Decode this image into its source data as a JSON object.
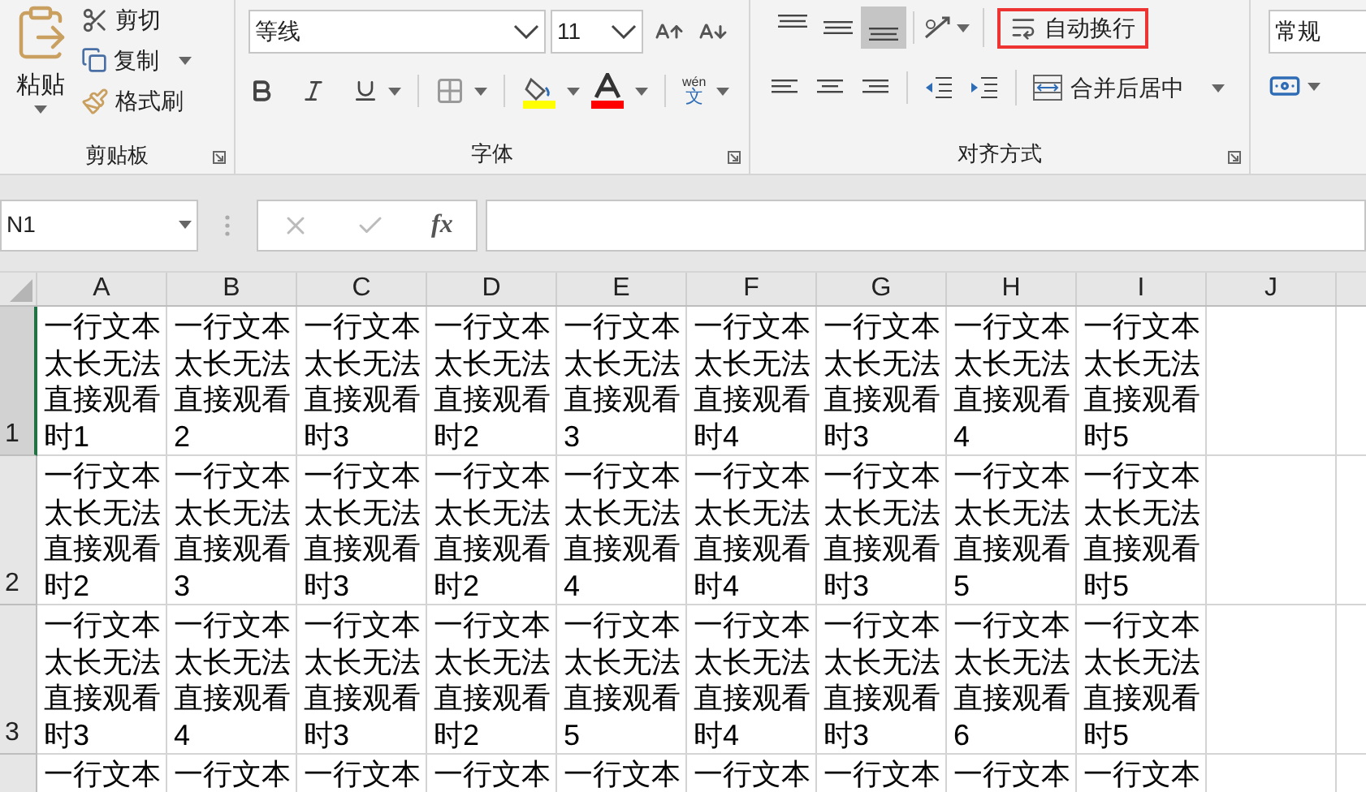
{
  "ribbon": {
    "clipboard": {
      "paste": "粘贴",
      "cut": "剪切",
      "copy": "复制",
      "format_painter": "格式刷",
      "label": "剪贴板"
    },
    "font": {
      "font_name": "等线",
      "font_size": "11",
      "phonetic_top": "wén",
      "phonetic_bottom": "文",
      "label": "字体"
    },
    "alignment": {
      "vertical": [
        {
          "kind": "top",
          "selected": false
        },
        {
          "kind": "middle",
          "selected": false
        },
        {
          "kind": "bottom",
          "selected": true
        }
      ],
      "wrap_text": {
        "label": "自动换行",
        "annotated": true
      },
      "merge": "合并后居中",
      "label": "对齐方式"
    },
    "number": {
      "format": "常规"
    }
  },
  "formula_bar": {
    "name_box": "N1",
    "fx": "fx"
  },
  "sheet": {
    "columns": [
      {
        "label": "A"
      },
      {
        "label": "B"
      },
      {
        "label": "C"
      },
      {
        "label": "D"
      },
      {
        "label": "E"
      },
      {
        "label": "F"
      },
      {
        "label": "G"
      },
      {
        "label": "H"
      },
      {
        "label": "I"
      },
      {
        "label": "J"
      }
    ],
    "rows": [
      {
        "label": "1",
        "selected": true,
        "cells": [
          "一行文本太长无法直接观看时1",
          "一行文本太长无法直接观看2",
          "一行文本太长无法直接观看时3",
          "一行文本太长无法直接观看时2",
          "一行文本太长无法直接观看3",
          "一行文本太长无法直接观看时4",
          "一行文本太长无法直接观看时3",
          "一行文本太长无法直接观看4",
          "一行文本太长无法直接观看时5"
        ]
      },
      {
        "label": "2",
        "selected": false,
        "cells": [
          "一行文本太长无法直接观看时2",
          "一行文本太长无法直接观看3",
          "一行文本太长无法直接观看时3",
          "一行文本太长无法直接观看时2",
          "一行文本太长无法直接观看4",
          "一行文本太长无法直接观看时4",
          "一行文本太长无法直接观看时3",
          "一行文本太长无法直接观看5",
          "一行文本太长无法直接观看时5"
        ]
      },
      {
        "label": "3",
        "selected": false,
        "cells": [
          "一行文本太长无法直接观看时3",
          "一行文本太长无法直接观看4",
          "一行文本太长无法直接观看时3",
          "一行文本太长无法直接观看时2",
          "一行文本太长无法直接观看5",
          "一行文本太长无法直接观看时4",
          "一行文本太长无法直接观看时3",
          "一行文本太长无法直接观看6",
          "一行文本太长无法直接观看时5"
        ]
      },
      {
        "cells": [
          "一行文本",
          "一行文本",
          "一行文本",
          "一行文本",
          "一行文本",
          "一行文本",
          "一行文本",
          "一行文本",
          "一行文本"
        ]
      }
    ]
  }
}
